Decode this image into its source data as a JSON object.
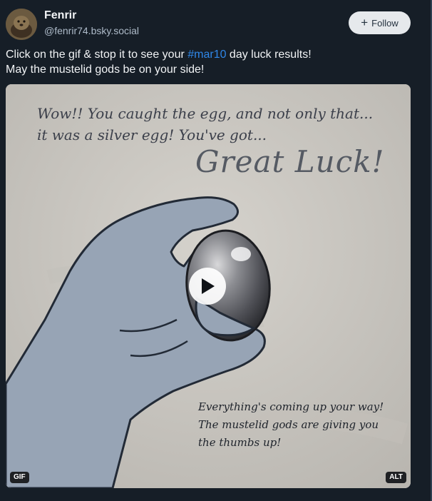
{
  "author": {
    "name": "Fenrir",
    "handle": "@fenrir74.bsky.social"
  },
  "follow": {
    "icon": "plus-icon",
    "label": "Follow"
  },
  "post": {
    "text_before": "Click on the gif & stop it to see your ",
    "hashtag": "#mar10",
    "text_after": " day luck results!",
    "line2": "May the mustelid gods be on your side!"
  },
  "media": {
    "caption_top_line1": "Wow!! You caught the egg, and not only that...",
    "caption_top_line2": "it was a silver egg! You've got...",
    "headline": "Great Luck!",
    "caption_bottom_line1": "Everything's coming up your way!",
    "caption_bottom_line2": "The mustelid gods are giving you",
    "caption_bottom_line3": "the thumbs up!",
    "play_icon": "play-icon",
    "gif_badge": "GIF",
    "alt_badge": "ALT"
  },
  "colors": {
    "background": "#161e27",
    "hashtag": "#2f87e8",
    "follow_button_bg": "#e6e9ec"
  }
}
